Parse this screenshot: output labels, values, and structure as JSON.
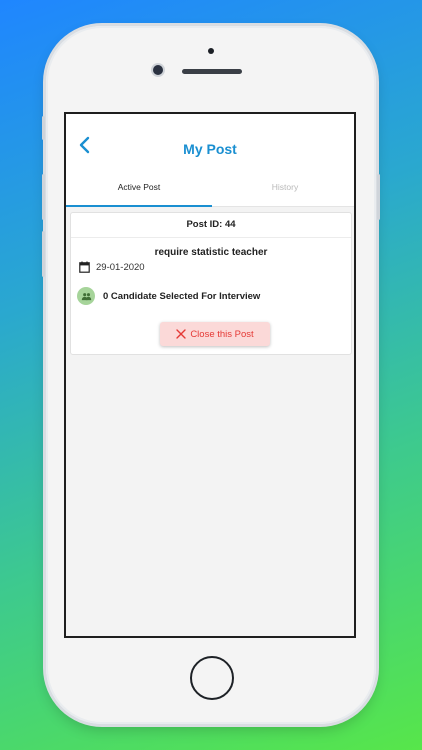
{
  "header": {
    "title": "My Post",
    "back_icon": "chevron-left-icon"
  },
  "tabs": [
    {
      "label": "Active Post",
      "active": true
    },
    {
      "label": "History",
      "active": false
    }
  ],
  "post": {
    "id_label": "Post ID: 44",
    "title": "require statistic teacher",
    "date": "29-01-2020",
    "candidates_text": "0 Candidate Selected For Interview",
    "close_button_label": "Close this Post"
  },
  "colors": {
    "accent": "#1a8fd1",
    "danger": "#e53935",
    "danger_bg": "#fbd9d8",
    "candidate_icon_bg": "#a6d49a"
  }
}
